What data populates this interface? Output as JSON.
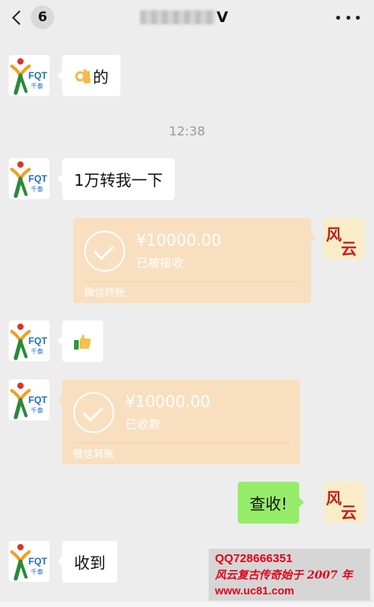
{
  "header": {
    "back_count": "6",
    "title_suffix": "V"
  },
  "contact_logo": {
    "letters": "FQT",
    "caption": "千泰"
  },
  "self_logo": {
    "text": "风云"
  },
  "messages": {
    "m1": {
      "text": "的",
      "emoji": "ok-hand"
    },
    "time1": "12:38",
    "m2": {
      "text": "1万转我一下"
    },
    "m3": {
      "amount": "¥10000.00",
      "status": "已被接收",
      "footer": "微信转账"
    },
    "m4": {
      "emoji": "thumbs-up"
    },
    "m5": {
      "amount": "¥10000.00",
      "status": "已收款",
      "footer": "微信转账"
    },
    "m6": {
      "text": "查收!"
    },
    "m7": {
      "text": "收到"
    }
  },
  "watermark": {
    "line1": "QQ728666351",
    "line2": "风云复古传奇始于 2007 年",
    "line3": "www.uc81.com"
  },
  "colors": {
    "background": "#ededed",
    "bubble_white": "#ffffff",
    "bubble_green": "#95ec69",
    "transfer_accepted": "#f8dfbf",
    "watermark_red": "#e2001a"
  }
}
